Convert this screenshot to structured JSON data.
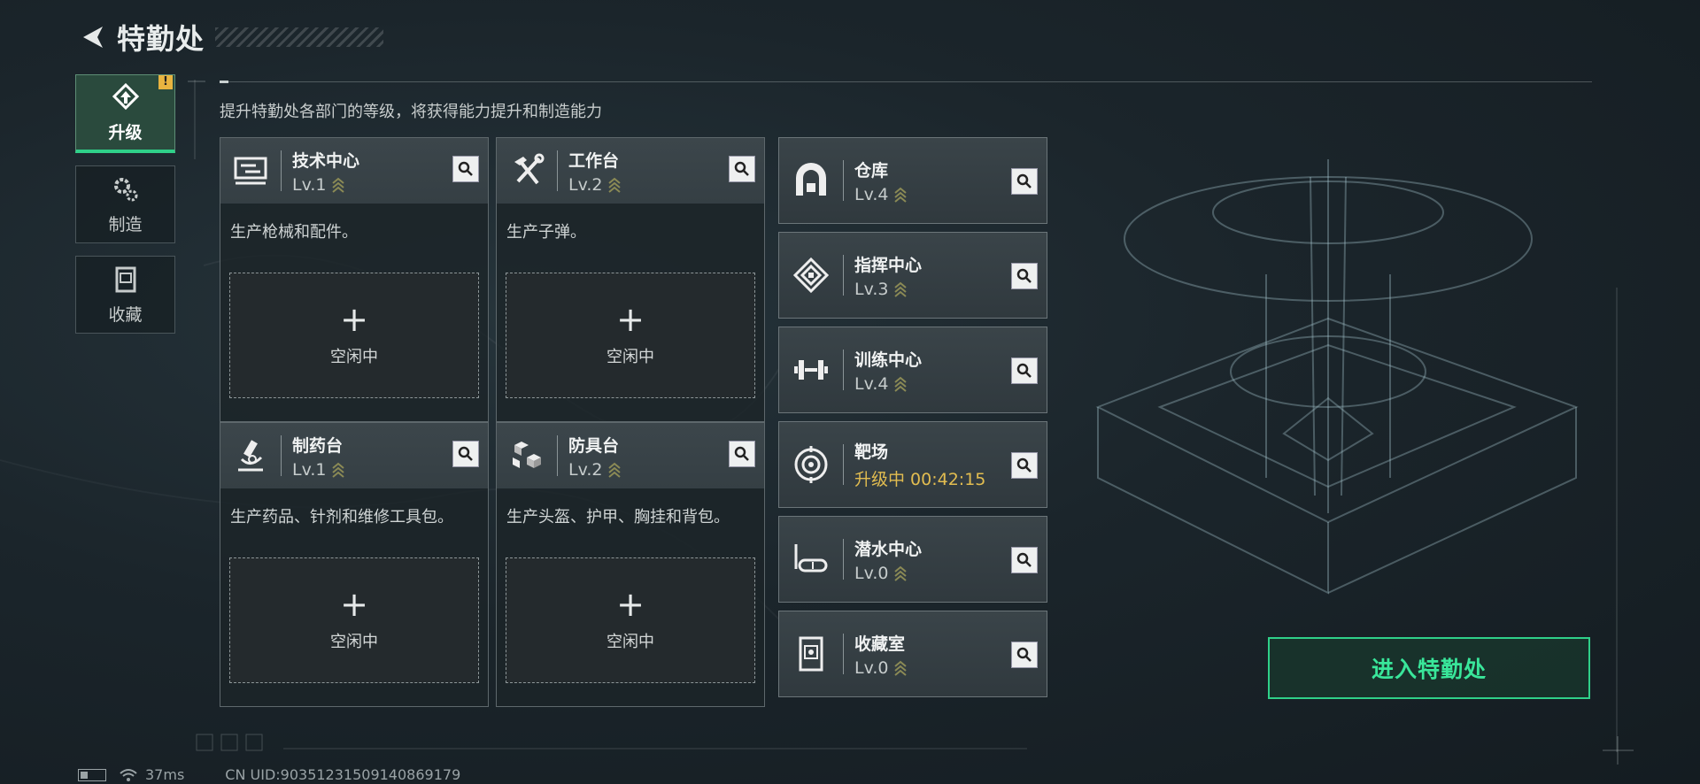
{
  "header": {
    "title": "特勤处"
  },
  "sidebar": {
    "tabs": [
      {
        "label": "升级",
        "icon": "upgrade-icon",
        "active": true,
        "alert": "!"
      },
      {
        "label": "制造",
        "icon": "gears-icon",
        "active": false
      },
      {
        "label": "收藏",
        "icon": "collection-icon",
        "active": false
      }
    ]
  },
  "main": {
    "subtitle": "提升特勤处各部门的等级，将获得能力提升和制造能力",
    "workshops": [
      {
        "name": "技术中心",
        "level": "Lv.1",
        "desc": "生产枪械和配件。",
        "slot_status": "空闲中",
        "icon": "monitor-icon"
      },
      {
        "name": "工作台",
        "level": "Lv.2",
        "desc": "生产子弹。",
        "slot_status": "空闲中",
        "icon": "hammer-wrench-icon"
      },
      {
        "name": "制药台",
        "level": "Lv.1",
        "desc": "生产药品、针剂和维修工具包。",
        "slot_status": "空闲中",
        "icon": "microscope-icon"
      },
      {
        "name": "防具台",
        "level": "Lv.2",
        "desc": "生产头盔、护甲、胸挂和背包。",
        "slot_status": "空闲中",
        "icon": "armor-cubes-icon"
      }
    ],
    "departments": [
      {
        "name": "仓库",
        "level": "Lv.4",
        "icon": "warehouse-icon"
      },
      {
        "name": "指挥中心",
        "level": "Lv.3",
        "icon": "command-icon"
      },
      {
        "name": "训练中心",
        "level": "Lv.4",
        "icon": "dumbbell-icon"
      },
      {
        "name": "靶场",
        "level": "升级中 00:42:15",
        "icon": "target-icon",
        "upgrading": true
      },
      {
        "name": "潜水中心",
        "level": "Lv.0",
        "icon": "diving-mask-icon"
      },
      {
        "name": "收藏室",
        "level": "Lv.0",
        "icon": "collection-room-icon"
      }
    ],
    "enter_button": "进入特勤处"
  },
  "status_bar": {
    "ping": "37ms",
    "uid": "CN UID:9035123150914086917­9"
  },
  "colors": {
    "accent": "#2fd089",
    "upgrading": "#e2bd50",
    "alert": "#e9b440"
  }
}
